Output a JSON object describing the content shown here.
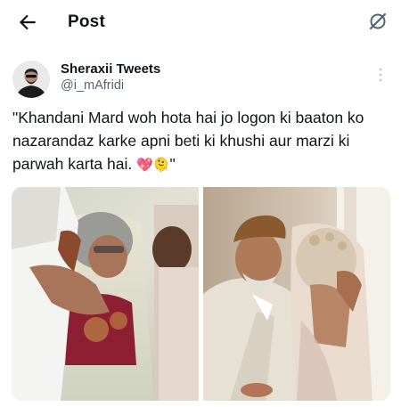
{
  "header": {
    "title": "Post",
    "back_icon": "arrow-left-icon",
    "grok_icon": "grok-icon"
  },
  "author": {
    "name": "Sheraxii Tweets",
    "handle": "@i_mAfridi",
    "avatar_icon": "avatar"
  },
  "tweet": {
    "text": "\"Khandani Mard woh hota hai jo logon ki baaton ko nazarandaz karke apni beti ki khushi aur marzi ki parwah karta hai. ",
    "emojis": "💖🫠",
    "closing_quote": "\""
  },
  "media": {
    "images": [
      {
        "icon": "photo-father-embracing-bride"
      },
      {
        "icon": "photo-father-kissing-bride-forehead"
      }
    ]
  },
  "colors": {
    "text": "#0f1419",
    "secondary": "#536471",
    "background": "#ffffff"
  }
}
